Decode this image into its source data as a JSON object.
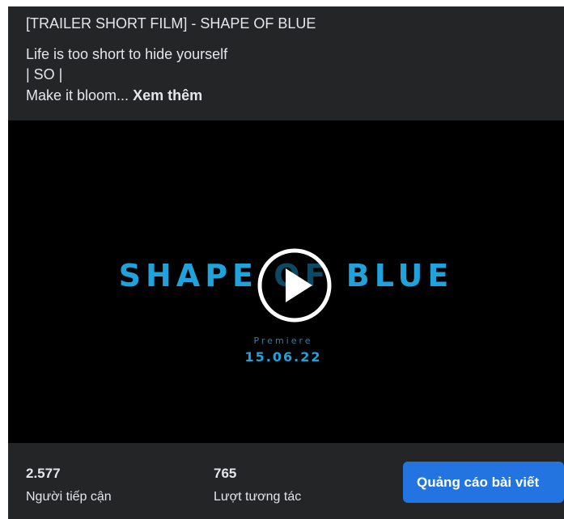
{
  "post": {
    "title": "[TRAILER SHORT FILM] - SHAPE OF BLUE",
    "line1": "Life is too short to hide yourself",
    "line2": "| SO |",
    "line3": "Make it bloom...",
    "see_more": "Xem thêm"
  },
  "video": {
    "film_title": "SHAPE OF BLUE",
    "premiere_label": "Premiere",
    "premiere_date": "15.06.22",
    "play_icon": "play-icon",
    "accent_color": "#1fa3dd"
  },
  "stats": {
    "reach_value": "2.577",
    "reach_label": "Người tiếp cận",
    "engagement_value": "765",
    "engagement_label": "Lượt tương tác"
  },
  "actions": {
    "boost_label": "Quảng cáo bài viết",
    "boost_color": "#2374e1"
  }
}
